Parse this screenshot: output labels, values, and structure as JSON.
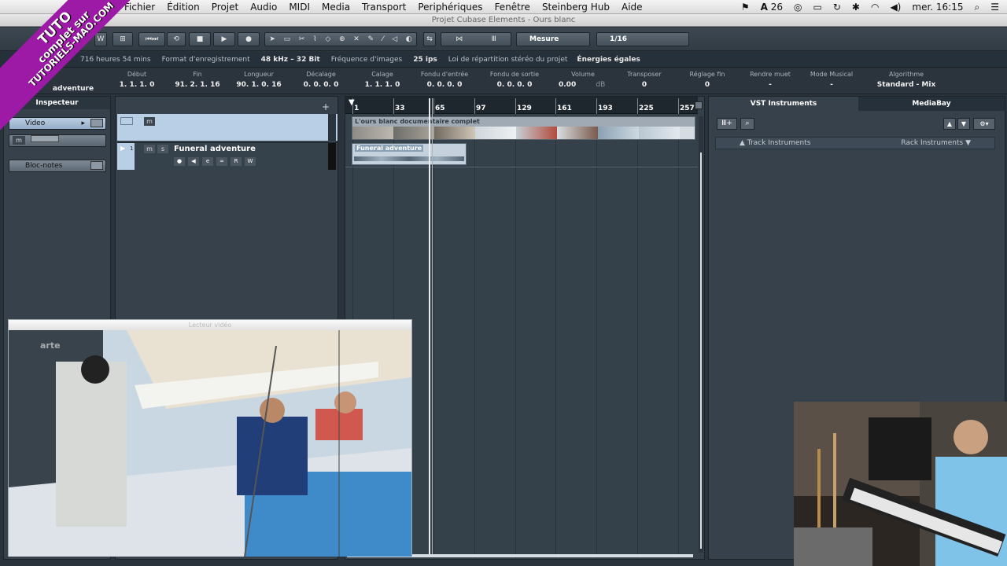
{
  "menubar": {
    "items": [
      "Fichier",
      "Édition",
      "Projet",
      "Audio",
      "MIDI",
      "Media",
      "Transport",
      "Periphériques",
      "Fenêtre",
      "Steinberg Hub",
      "Aide"
    ],
    "status": {
      "adobe_count": "26",
      "clock": "mer. 16:15"
    }
  },
  "window": {
    "title": "Projet Cubase Elements - Ours blanc"
  },
  "toolbar": {
    "mode_btn": "W",
    "grid_type": "Mesure",
    "quantize": "1/16"
  },
  "statusline": {
    "record_time": "716 heures 54 mins",
    "record_format_label": "Format d'enregistrement",
    "record_format": "48 kHz – 32 Bit",
    "frame_rate_label": "Fréquence d'images",
    "frame_rate": "25 ips",
    "pan_law_label": "Loi de répartition stéréo du projet",
    "pan_law": "Énergies égales"
  },
  "infoline": {
    "name": "adventure",
    "columns": [
      {
        "label": "Début",
        "value": "1. 1. 1. 0"
      },
      {
        "label": "Fin",
        "value": "91. 2. 1. 16"
      },
      {
        "label": "Longueur",
        "value": "90. 1. 0. 16"
      },
      {
        "label": "Décalage",
        "value": "0. 0. 0. 0"
      },
      {
        "label": "Calage",
        "value": "1. 1. 1. 0"
      },
      {
        "label": "Fondu d'entrée",
        "value": "0. 0. 0. 0"
      },
      {
        "label": "Fondu de sortie",
        "value": "0. 0. 0. 0"
      },
      {
        "label": "Volume",
        "value": "0.00"
      },
      {
        "label": "Transposer",
        "value": "0"
      },
      {
        "label": "Réglage fin",
        "value": "0"
      },
      {
        "label": "Rendre muet",
        "value": "-"
      },
      {
        "label": "Mode Musical",
        "value": "-"
      },
      {
        "label": "Algorithme",
        "value": "Standard - Mix"
      }
    ],
    "volume_unit": "dB"
  },
  "inspector": {
    "title": "Inspecteur",
    "video_label": "Video",
    "notes_label": "Bloc-notes"
  },
  "tracks": {
    "audio_track_number": "1",
    "audio_track_name": "Funeral adventure",
    "video_clip_name": "L'ours blanc documentaire complet",
    "audio_event_name": "Funeral adventure"
  },
  "ruler": {
    "marks": [
      "1",
      "33",
      "65",
      "97",
      "129",
      "161",
      "193",
      "225",
      "257"
    ]
  },
  "rightzone": {
    "tab_vst": "VST Instruments",
    "tab_mediabay": "MediaBay",
    "track_instruments": "Track Instruments",
    "rack_instruments": "Rack Instruments"
  },
  "video_player": {
    "title": "Lecteur vidéo",
    "channel_logo": "arte"
  },
  "banner": {
    "line1": "TUTO",
    "line2": "complet sur",
    "line3": "TUTORIELS-MAO.COM"
  },
  "colors": {
    "accent": "#9c1aa6",
    "selection": "#b8cfe6",
    "background": "#2f3943"
  }
}
